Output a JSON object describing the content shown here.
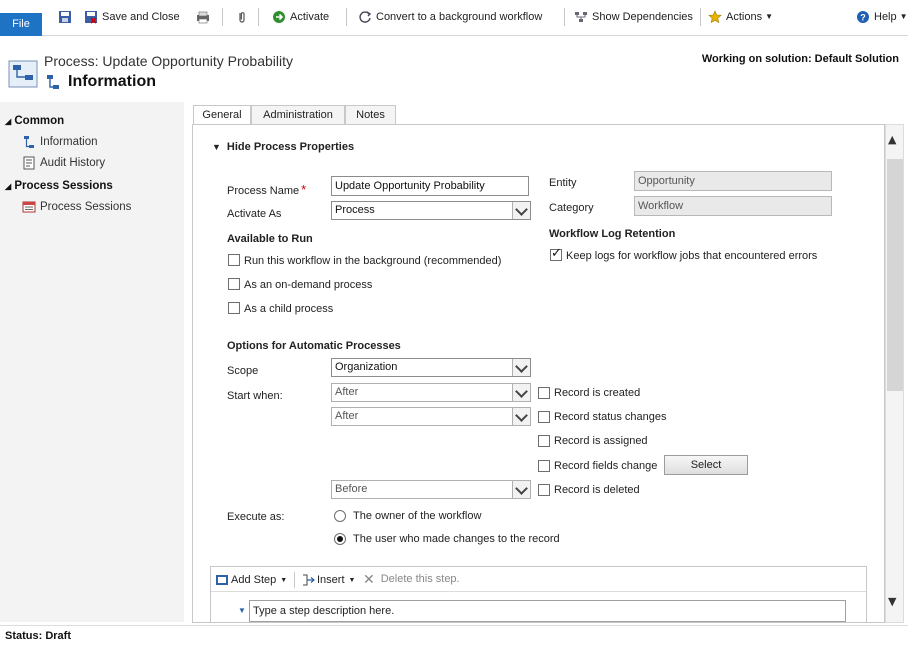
{
  "ribbon": {
    "file_label": "File",
    "save_close_label": "Save and Close",
    "activate_label": "Activate",
    "convert_label": "Convert to a background workflow",
    "dependencies_label": "Show Dependencies",
    "actions_label": "Actions",
    "help_label": "Help"
  },
  "header": {
    "process_label": "Process: Update Opportunity Probability",
    "title": "Information",
    "solution": "Working on solution: Default Solution"
  },
  "nav": {
    "common_label": "Common",
    "items_common": [
      "Information",
      "Audit History"
    ],
    "sessions_label": "Process Sessions",
    "items_sessions": [
      "Process Sessions"
    ]
  },
  "tabs": [
    "General",
    "Administration",
    "Notes"
  ],
  "form": {
    "section_toggle": "Hide Process Properties",
    "process_name_label": "Process Name",
    "required_mark": "*",
    "process_name_value": "Update Opportunity Probability",
    "activate_as_label": "Activate As",
    "activate_as_value": "Process",
    "entity_label": "Entity",
    "entity_value": "Opportunity",
    "category_label": "Category",
    "category_value": "Workflow",
    "available_heading": "Available to Run",
    "opt_background": "Run this workflow in the background (recommended)",
    "opt_on_demand": "As an on-demand process",
    "opt_child": "As a child process",
    "log_heading": "Workflow Log Retention",
    "log_keep": "Keep logs for workflow jobs that encountered errors",
    "options_heading": "Options for Automatic Processes",
    "scope_label": "Scope",
    "scope_value": "Organization",
    "start_when_label": "Start when:",
    "start_after_1": "After",
    "start_after_2": "After",
    "start_before": "Before",
    "rec_created": "Record is created",
    "rec_status": "Record status changes",
    "rec_assigned": "Record is assigned",
    "rec_fields": "Record fields change",
    "select_btn": "Select",
    "rec_deleted": "Record is deleted",
    "execute_as_label": "Execute as:",
    "exec_owner": "The owner of the workflow",
    "exec_user": "The user who made changes to the record"
  },
  "steps": {
    "add_step": "Add Step",
    "insert": "Insert",
    "delete": "Delete this step.",
    "placeholder": "Type a step description here."
  },
  "status": "Status: Draft"
}
